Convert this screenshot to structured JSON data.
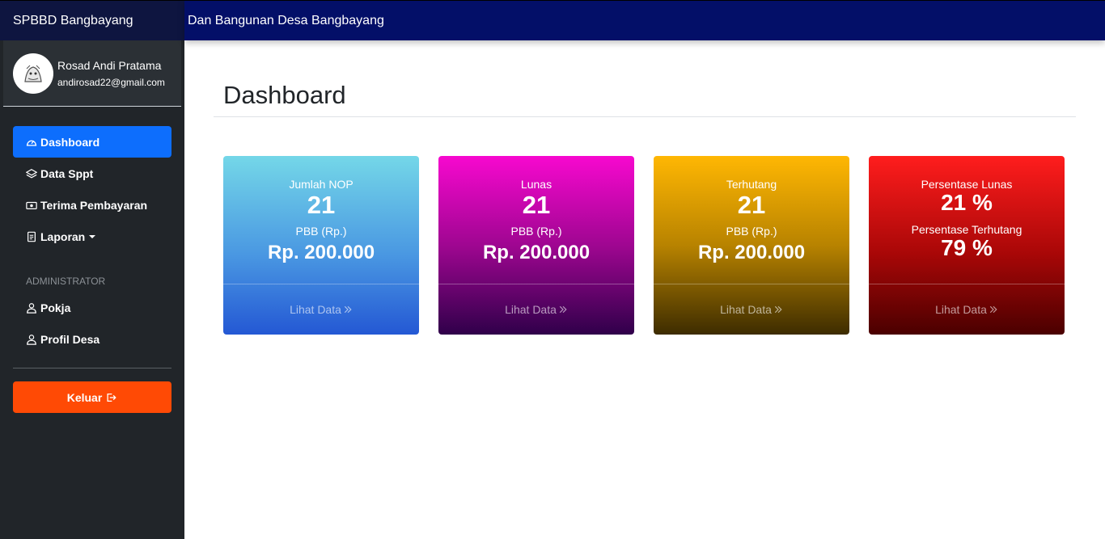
{
  "sidebar": {
    "brand": "SPBBD Bangbayang",
    "user": {
      "name": "Rosad Andi Pratama",
      "email": "andirosad22@gmail.com"
    },
    "nav": {
      "dashboard": "Dashboard",
      "data_sppt": "Data Sppt",
      "terima_pembayaran": "Terima Pembayaran",
      "laporan": "Laporan",
      "heading_admin": "ADMINISTRATOR",
      "pokja": "Pokja",
      "profil_desa": "Profil Desa"
    },
    "logout": "Keluar"
  },
  "topbar": {
    "title": "Dan Bangunan Desa Bangbayang"
  },
  "main": {
    "title": "Dashboard",
    "cards": [
      {
        "label": "Jumlah NOP",
        "value": "21",
        "sub_label": "PBB (Rp.)",
        "sub_value": "Rp. 200.000",
        "footer": "Lihat Data"
      },
      {
        "label": "Lunas",
        "value": "21",
        "sub_label": "PBB (Rp.)",
        "sub_value": "Rp. 200.000",
        "footer": "Lihat Data"
      },
      {
        "label": "Terhutang",
        "value": "21",
        "sub_label": "PBB (Rp.)",
        "sub_value": "Rp. 200.000",
        "footer": "Lihat Data"
      },
      {
        "label": "Persentase Lunas",
        "value": "21 %",
        "sub_label": "Persentase Terhutang",
        "sub_value": "79 %",
        "footer": "Lihat Data"
      }
    ]
  },
  "colors": {
    "sidebar_bg": "#212529",
    "topbar_bg": "#030f68",
    "active_nav": "#0d6efd",
    "logout_btn": "#ff4a05"
  }
}
